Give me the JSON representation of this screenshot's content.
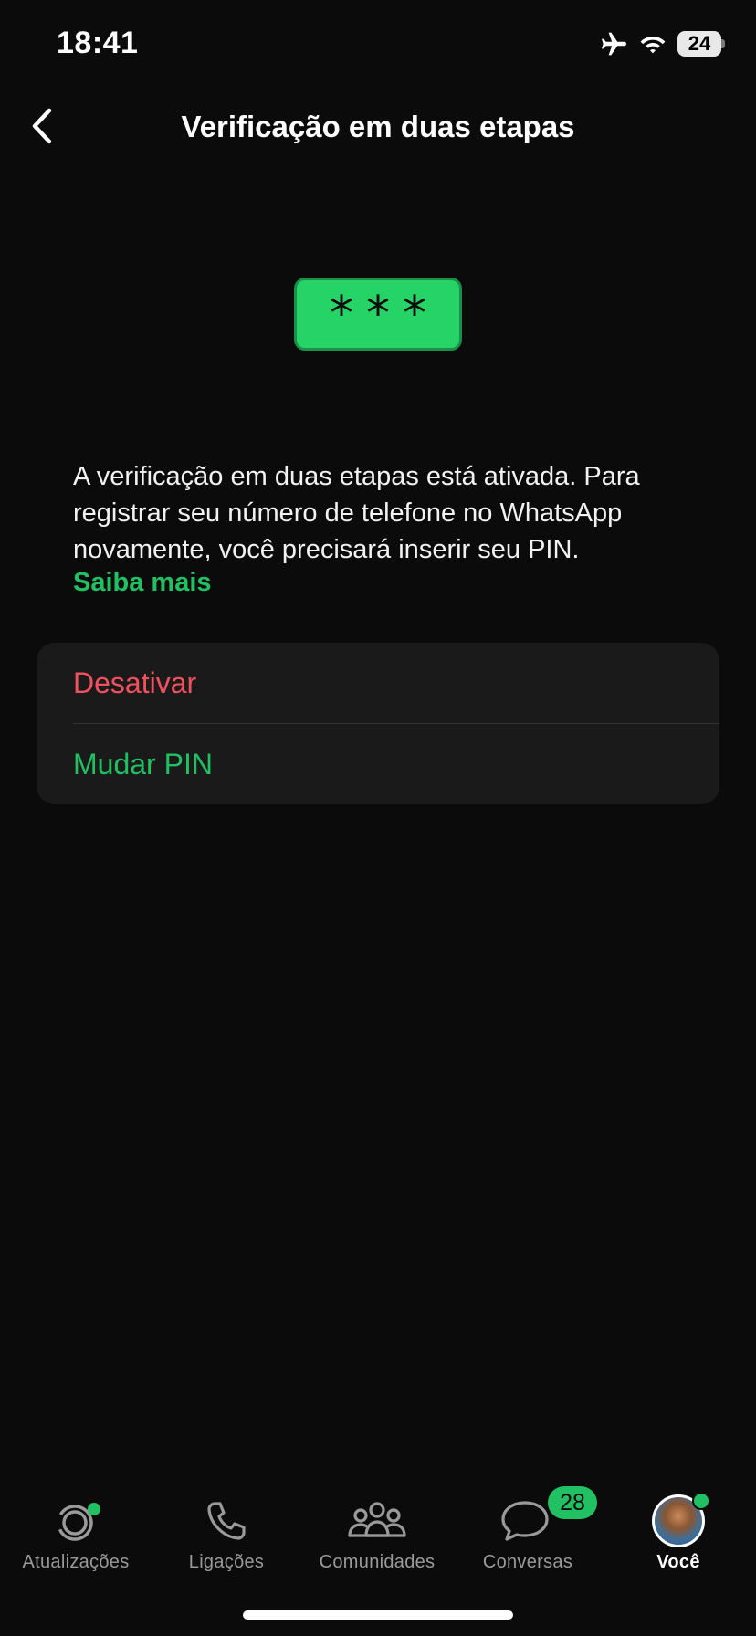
{
  "status_bar": {
    "time": "18:41",
    "battery_level": "24",
    "icons": [
      "airplane-icon",
      "wifi-icon",
      "battery-icon"
    ]
  },
  "header": {
    "title": "Verificação em duas etapas",
    "back_icon": "chevron-left-icon"
  },
  "illustration": {
    "pin_mask": "***",
    "color": "#25d366"
  },
  "description": {
    "text": "A verificação em duas etapas está ativada. Para registrar seu número de telefone no WhatsApp novamente, você precisará inserir seu PIN.",
    "learn_more": "Saiba mais"
  },
  "options": [
    {
      "label": "Desativar",
      "color": "#f1505e"
    },
    {
      "label": "Mudar PIN",
      "color": "#21c063"
    }
  ],
  "tab_bar": {
    "tabs": [
      {
        "label": "Atualizações",
        "icon": "updates-icon",
        "has_dot": true
      },
      {
        "label": "Ligações",
        "icon": "phone-icon"
      },
      {
        "label": "Comunidades",
        "icon": "communities-icon"
      },
      {
        "label": "Conversas",
        "icon": "chats-icon",
        "badge": "28"
      },
      {
        "label": "Você",
        "icon": "avatar",
        "active": true,
        "has_dot": true
      }
    ]
  },
  "colors": {
    "background": "#0b0b0b",
    "accent": "#21c063",
    "danger": "#f1505e",
    "card": "#1a1a1a"
  }
}
